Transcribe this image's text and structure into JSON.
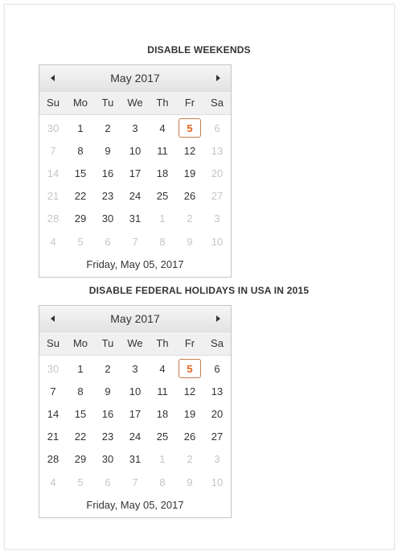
{
  "section1": {
    "title": "DISABLE WEEKENDS"
  },
  "section2": {
    "title": "DISABLE FEDERAL HOLIDAYS IN USA IN 2015"
  },
  "calendars": [
    {
      "month_title": "May 2017",
      "weekdays": [
        "Su",
        "Mo",
        "Tu",
        "We",
        "Th",
        "Fr",
        "Sa"
      ],
      "footer": "Friday, May 05, 2017",
      "selected": 5,
      "weeks": [
        [
          {
            "d": "30",
            "s": "other"
          },
          {
            "d": "1",
            "s": ""
          },
          {
            "d": "2",
            "s": ""
          },
          {
            "d": "3",
            "s": ""
          },
          {
            "d": "4",
            "s": ""
          },
          {
            "d": "5",
            "s": "selected"
          },
          {
            "d": "6",
            "s": "disabled"
          }
        ],
        [
          {
            "d": "7",
            "s": "disabled"
          },
          {
            "d": "8",
            "s": ""
          },
          {
            "d": "9",
            "s": ""
          },
          {
            "d": "10",
            "s": ""
          },
          {
            "d": "11",
            "s": ""
          },
          {
            "d": "12",
            "s": ""
          },
          {
            "d": "13",
            "s": "disabled"
          }
        ],
        [
          {
            "d": "14",
            "s": "disabled"
          },
          {
            "d": "15",
            "s": ""
          },
          {
            "d": "16",
            "s": ""
          },
          {
            "d": "17",
            "s": ""
          },
          {
            "d": "18",
            "s": ""
          },
          {
            "d": "19",
            "s": ""
          },
          {
            "d": "20",
            "s": "disabled"
          }
        ],
        [
          {
            "d": "21",
            "s": "disabled"
          },
          {
            "d": "22",
            "s": ""
          },
          {
            "d": "23",
            "s": ""
          },
          {
            "d": "24",
            "s": ""
          },
          {
            "d": "25",
            "s": ""
          },
          {
            "d": "26",
            "s": ""
          },
          {
            "d": "27",
            "s": "disabled"
          }
        ],
        [
          {
            "d": "28",
            "s": "disabled"
          },
          {
            "d": "29",
            "s": ""
          },
          {
            "d": "30",
            "s": ""
          },
          {
            "d": "31",
            "s": ""
          },
          {
            "d": "1",
            "s": "other"
          },
          {
            "d": "2",
            "s": "other"
          },
          {
            "d": "3",
            "s": "other"
          }
        ],
        [
          {
            "d": "4",
            "s": "other"
          },
          {
            "d": "5",
            "s": "other"
          },
          {
            "d": "6",
            "s": "other"
          },
          {
            "d": "7",
            "s": "other"
          },
          {
            "d": "8",
            "s": "other"
          },
          {
            "d": "9",
            "s": "other"
          },
          {
            "d": "10",
            "s": "other"
          }
        ]
      ]
    },
    {
      "month_title": "May 2017",
      "weekdays": [
        "Su",
        "Mo",
        "Tu",
        "We",
        "Th",
        "Fr",
        "Sa"
      ],
      "footer": "Friday, May 05, 2017",
      "selected": 5,
      "weeks": [
        [
          {
            "d": "30",
            "s": "other"
          },
          {
            "d": "1",
            "s": ""
          },
          {
            "d": "2",
            "s": ""
          },
          {
            "d": "3",
            "s": ""
          },
          {
            "d": "4",
            "s": ""
          },
          {
            "d": "5",
            "s": "selected"
          },
          {
            "d": "6",
            "s": ""
          }
        ],
        [
          {
            "d": "7",
            "s": ""
          },
          {
            "d": "8",
            "s": ""
          },
          {
            "d": "9",
            "s": ""
          },
          {
            "d": "10",
            "s": ""
          },
          {
            "d": "11",
            "s": ""
          },
          {
            "d": "12",
            "s": ""
          },
          {
            "d": "13",
            "s": ""
          }
        ],
        [
          {
            "d": "14",
            "s": ""
          },
          {
            "d": "15",
            "s": ""
          },
          {
            "d": "16",
            "s": ""
          },
          {
            "d": "17",
            "s": ""
          },
          {
            "d": "18",
            "s": ""
          },
          {
            "d": "19",
            "s": ""
          },
          {
            "d": "20",
            "s": ""
          }
        ],
        [
          {
            "d": "21",
            "s": ""
          },
          {
            "d": "22",
            "s": ""
          },
          {
            "d": "23",
            "s": ""
          },
          {
            "d": "24",
            "s": ""
          },
          {
            "d": "25",
            "s": ""
          },
          {
            "d": "26",
            "s": ""
          },
          {
            "d": "27",
            "s": ""
          }
        ],
        [
          {
            "d": "28",
            "s": ""
          },
          {
            "d": "29",
            "s": ""
          },
          {
            "d": "30",
            "s": ""
          },
          {
            "d": "31",
            "s": ""
          },
          {
            "d": "1",
            "s": "other"
          },
          {
            "d": "2",
            "s": "other"
          },
          {
            "d": "3",
            "s": "other"
          }
        ],
        [
          {
            "d": "4",
            "s": "other"
          },
          {
            "d": "5",
            "s": "other"
          },
          {
            "d": "6",
            "s": "other"
          },
          {
            "d": "7",
            "s": "other"
          },
          {
            "d": "8",
            "s": "other"
          },
          {
            "d": "9",
            "s": "other"
          },
          {
            "d": "10",
            "s": "other"
          }
        ]
      ]
    }
  ],
  "colors": {
    "selected_text": "#e4651a",
    "selected_border": "#c77d4a",
    "muted_text": "#c6c6c6"
  }
}
